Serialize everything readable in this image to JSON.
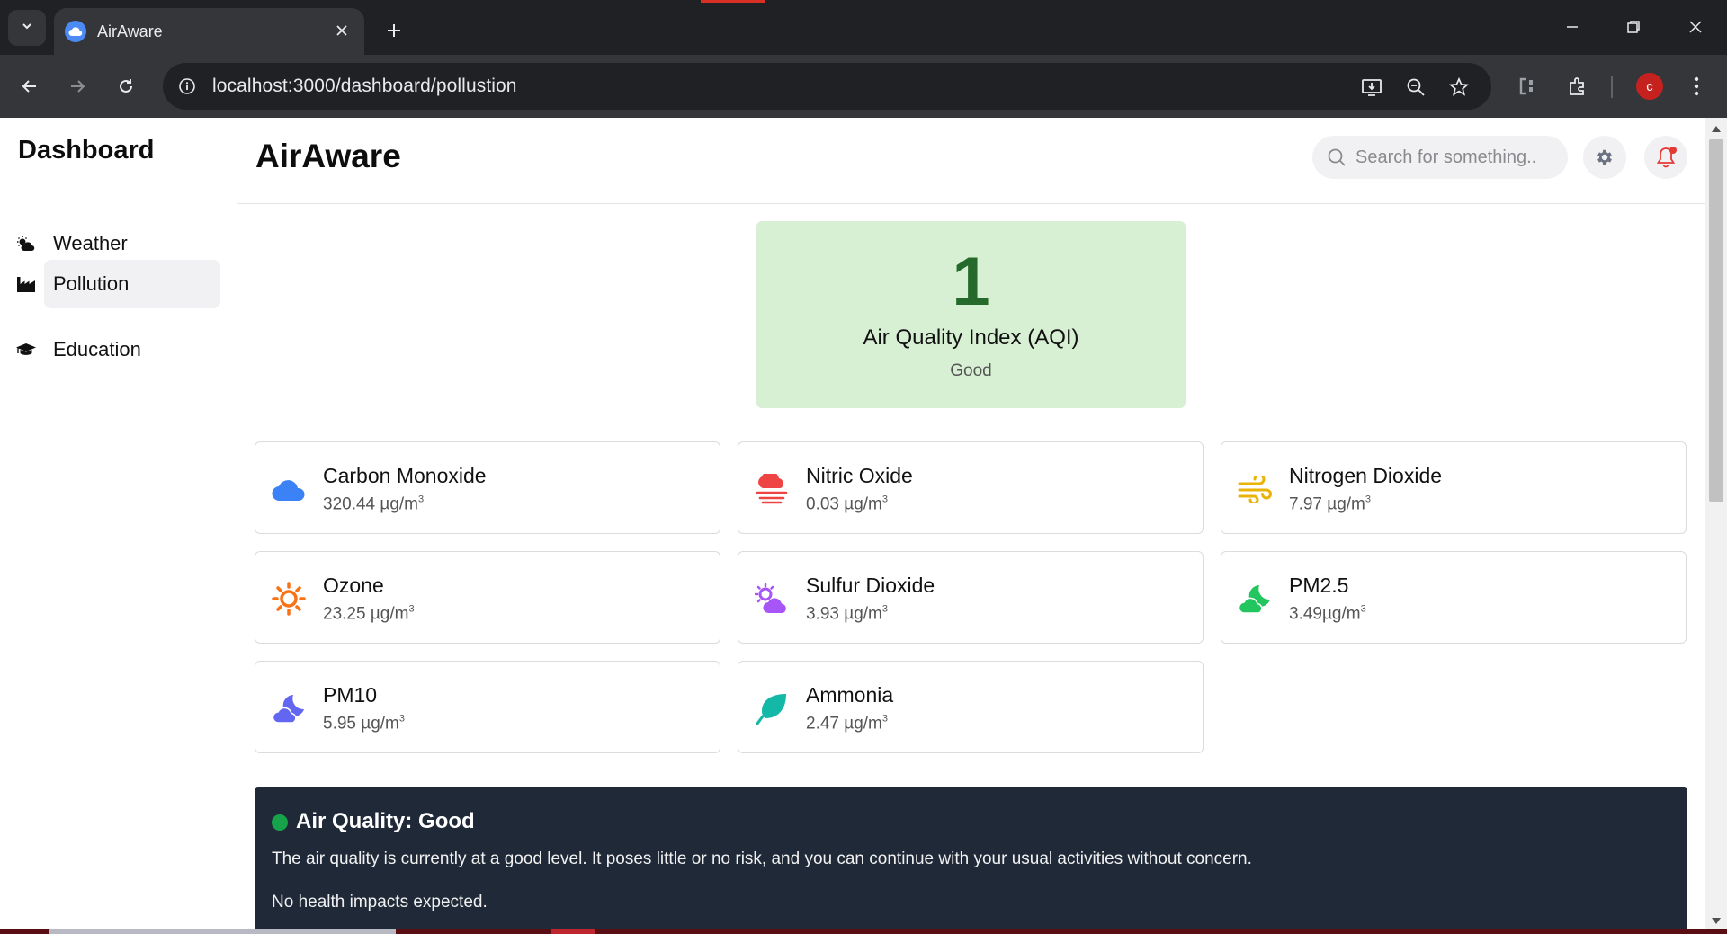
{
  "browser": {
    "tab_title": "AirAware",
    "url": "localhost:3000/dashboard/pollustion",
    "profile_initial": "c"
  },
  "sidebar": {
    "title": "Dashboard",
    "items": [
      {
        "label": "Weather",
        "icon": "cloud-sun-icon",
        "active": false
      },
      {
        "label": "Pollution",
        "icon": "factory-icon",
        "active": true
      },
      {
        "label": "Education",
        "icon": "graduation-cap-icon",
        "active": false
      }
    ]
  },
  "header": {
    "title": "AirAware",
    "search_placeholder": "Search for something.."
  },
  "aqi": {
    "value": "1",
    "label": "Air Quality Index (AQI)",
    "status": "Good",
    "color": "#d7f0d3"
  },
  "pollutants": [
    {
      "name": "Carbon Monoxide",
      "value": "320.44 µg/m",
      "icon": "cloud-icon",
      "color": "#3b82f6"
    },
    {
      "name": "Nitric Oxide",
      "value": "0.03 µg/m",
      "icon": "fog-cloud-icon",
      "color": "#ef4444"
    },
    {
      "name": "Nitrogen Dioxide",
      "value": "7.97 µg/m",
      "icon": "wind-icon",
      "color": "#eab308"
    },
    {
      "name": "Ozone",
      "value": "23.25 µg/m",
      "icon": "sun-icon",
      "color": "#f97316"
    },
    {
      "name": "Sulfur Dioxide",
      "value": "3.93 µg/m",
      "icon": "cloud-sun-icon",
      "color": "#a855f7"
    },
    {
      "name": "PM2.5",
      "value": "3.49µg/m",
      "icon": "cloud-moon-icon",
      "color": "#22c55e"
    },
    {
      "name": "PM10",
      "value": "5.95 µg/m",
      "icon": "cloud-moon-icon",
      "color": "#6366f1"
    },
    {
      "name": "Ammonia",
      "value": "2.47 µg/m",
      "icon": "leaf-icon",
      "color": "#14b8a6"
    }
  ],
  "unit_superscript": "3",
  "air_quality_info": {
    "title": "Air Quality: Good",
    "description": "The air quality is currently at a good level. It poses little or no risk, and you can continue with your usual activities without concern.",
    "impact": "No health impacts expected.",
    "status_color": "#16a34a"
  }
}
